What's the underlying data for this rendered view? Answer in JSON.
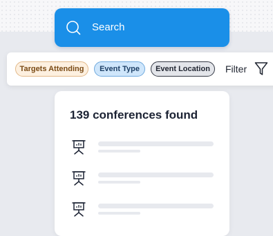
{
  "search": {
    "placeholder": "Search",
    "icon": "search-icon"
  },
  "filters": {
    "chips": [
      {
        "label": "Targets Attending"
      },
      {
        "label": "Event Type"
      },
      {
        "label": "Event Location"
      }
    ],
    "filter_label": "Filter",
    "filter_icon": "funnel-icon"
  },
  "results": {
    "title": "139 conferences found",
    "row_icon": "presentation-board-icon",
    "row_count": 3
  },
  "colors": {
    "accent": "#1a8fe8",
    "chip_targets_bg": "#fdf0e0",
    "chip_event_type_bg": "#cfe6fb",
    "chip_event_location_bg": "#e3e5ea"
  }
}
